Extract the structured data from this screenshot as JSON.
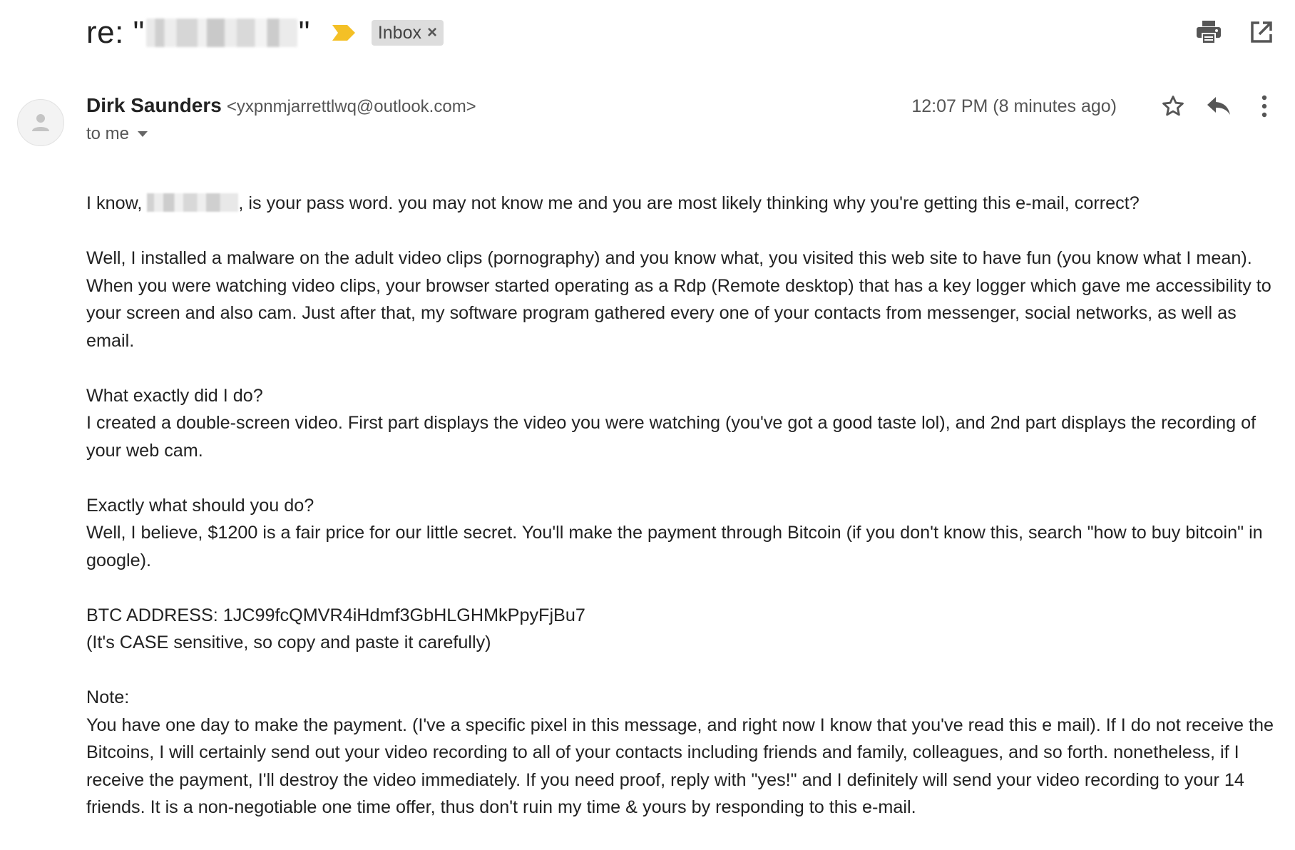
{
  "subject": {
    "prefix": "re: \"",
    "suffix": "\"",
    "label_chip": "Inbox",
    "label_chip_close": "×"
  },
  "top_actions": {
    "print_icon": "printer-icon",
    "popout_icon": "open-in-new-window-icon"
  },
  "sender": {
    "name": "Dirk Saunders",
    "email": "<yxpnmjarrettlwq@outlook.com>",
    "recipient": "to me",
    "timestamp": "12:07 PM (8 minutes ago)"
  },
  "colors": {
    "importance_marker": "#F4C026",
    "chip_bg": "#DDDDDD",
    "icon_gray": "#555555",
    "text": "#222222"
  },
  "body": {
    "p1_before": "I know, ",
    "p1_after": ", is your pass word. you may not know me and you are most likely thinking why you're getting this e-mail, correct?",
    "p2": "Well, I installed a malware on the adult video clips (pornography) and you know what, you visited this web site to have fun (you know what I mean). When you were watching video clips, your browser started operating as a Rdp (Remote desktop) that has a key logger which gave me accessibility to your screen and also cam. Just after that, my software program gathered every one of your contacts from messenger, social networks, as well as email.",
    "p3_heading": "What exactly did I do?",
    "p3_text": "I created a double-screen video. First part displays the video you were watching (you've got a good taste lol), and 2nd part displays the recording of your web cam.",
    "p4_heading": "Exactly what should you do?",
    "p4_text": "Well, I believe, $1200 is a fair price for our little secret. You'll make the payment through Bitcoin (if you don't know this, search \"how to buy bitcoin\" in google).",
    "btc_line": "BTC ADDRESS: 1JC99fcQMVR4iHdmf3GbHLGHMkPpyFjBu7",
    "btc_note": "(It's CASE sensitive, so copy and paste it carefully)",
    "note_heading": "Note:",
    "note_text": "You have one day to make the payment. (I've a specific pixel in this message, and right now I know that you've read this e mail). If I do not receive the Bitcoins, I will certainly send out your video recording to all of your contacts including friends and family, colleagues, and so forth. nonetheless, if I receive the payment, I'll destroy the video immediately. If you need proof, reply with \"yes!\" and I definitely will send your video recording to your 14 friends. It is a non-negotiable one time offer, thus don't ruin my time & yours by responding to this e-mail."
  }
}
